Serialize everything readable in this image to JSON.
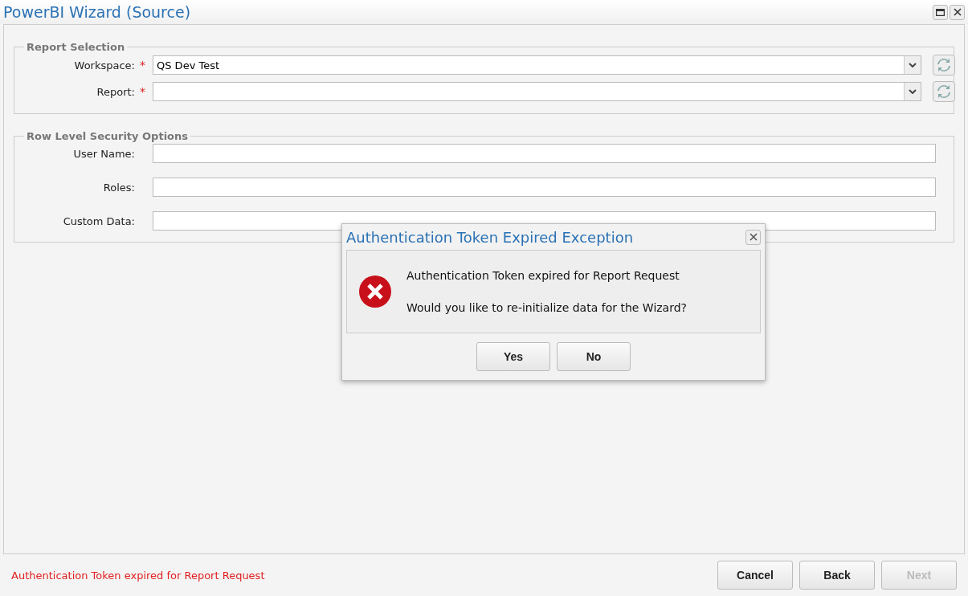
{
  "window": {
    "title": "PowerBI Wizard (Source)"
  },
  "sections": [
    {
      "legend": "Report Selection",
      "fields": [
        {
          "label": "Workspace:",
          "required_mark": "*",
          "kind": "combo",
          "value": "QS Dev Test"
        },
        {
          "label": "Report:",
          "required_mark": "*",
          "kind": "combo"
        }
      ]
    },
    {
      "legend": "Row Level Security Options",
      "fields": [
        {
          "label": "User Name:",
          "kind": "text"
        },
        {
          "label": "Roles:",
          "kind": "text"
        },
        {
          "label": "Custom Data:",
          "kind": "text"
        }
      ]
    }
  ],
  "dialog": {
    "title": "Authentication Token Expired Exception",
    "messages": [
      "Authentication Token expired for Report Request",
      "Would you like to re-initialize data for the Wizard?"
    ],
    "buttons": [
      {
        "label": "Yes"
      },
      {
        "label": "No"
      }
    ]
  },
  "status_bar": {
    "message": "Authentication Token expired for Report Request",
    "buttons": [
      {
        "label": "Cancel",
        "disabled": false
      },
      {
        "label": "Back",
        "disabled": false
      },
      {
        "label": "Next",
        "disabled": true
      }
    ]
  }
}
